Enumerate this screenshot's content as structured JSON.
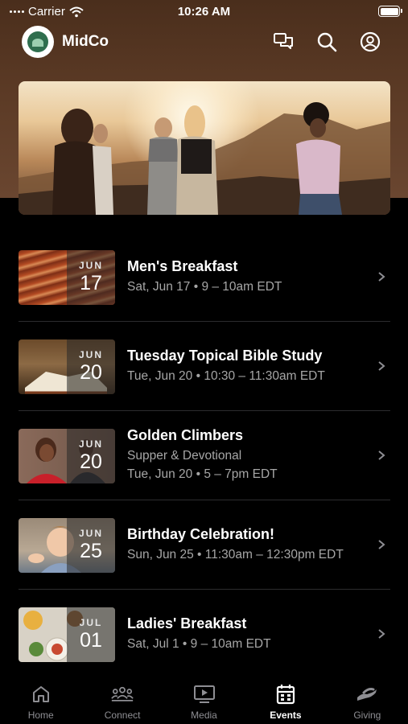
{
  "status_bar": {
    "carrier": "Carrier",
    "time": "10:26 AM"
  },
  "app": {
    "title": "MidCo"
  },
  "events": [
    {
      "title": "Men's Breakfast",
      "subtitle": "",
      "time": "Sat, Jun 17 • 9 – 10am EDT",
      "month": "JUN",
      "day": "17",
      "thumb": "bacon"
    },
    {
      "title": "Tuesday Topical Bible Study",
      "subtitle": "",
      "time": "Tue, Jun 20 • 10:30 – 11:30am EDT",
      "month": "JUN",
      "day": "20",
      "thumb": "bible"
    },
    {
      "title": "Golden Climbers",
      "subtitle": "Supper & Devotional",
      "time": "Tue, Jun 20 • 5 – 7pm EDT",
      "month": "JUN",
      "day": "20",
      "thumb": "couple"
    },
    {
      "title": "Birthday Celebration!",
      "subtitle": "",
      "time": "Sun, Jun 25 • 11:30am – 12:30pm EDT",
      "month": "JUN",
      "day": "25",
      "thumb": "child"
    },
    {
      "title": "Ladies' Breakfast",
      "subtitle": "",
      "time": "Sat, Jul 1 • 9 – 10am EDT",
      "month": "JUL",
      "day": "01",
      "thumb": "food"
    }
  ],
  "tabs": [
    {
      "label": "Home",
      "icon": "home-icon",
      "active": false
    },
    {
      "label": "Connect",
      "icon": "people-icon",
      "active": false
    },
    {
      "label": "Media",
      "icon": "play-screen-icon",
      "active": false
    },
    {
      "label": "Events",
      "icon": "calendar-icon",
      "active": true
    },
    {
      "label": "Giving",
      "icon": "giving-hand-icon",
      "active": false
    }
  ],
  "colors": {
    "header": "#5b3a25",
    "background": "#000000",
    "inactive_tab": "#8e8e93",
    "active_tab": "#ffffff"
  }
}
